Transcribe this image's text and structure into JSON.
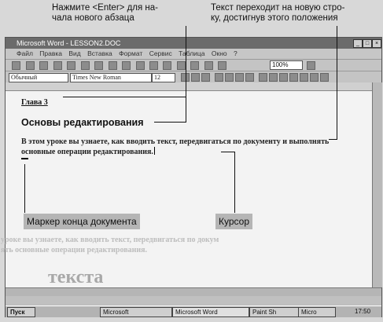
{
  "callouts": {
    "enter": [
      "Нажмите <Enter> для на-",
      "чала нового абзаца"
    ],
    "wrap": [
      "Текст переходит на новую стро-",
      "ку, достигнув этого положения"
    ],
    "end_marker": "Маркер конца документа",
    "cursor": "Курсор"
  },
  "window": {
    "title": "Microsoft Word - LESSON2.DOC",
    "menus": [
      "Файл",
      "Правка",
      "Вид",
      "Вставка",
      "Формат",
      "Сервис",
      "Таблица",
      "Окно",
      "?"
    ]
  },
  "format_bar": {
    "style": "Обычный",
    "font": "Times New Roman",
    "size": "12",
    "zoom": "100%"
  },
  "document": {
    "chapter": "Глава 3",
    "heading": "Основы редактирования",
    "body": "В этом уроке вы узнаете, как вводить текст, передвигаться по документу и выполнять основные операции редактирования."
  },
  "background_text": {
    "line1": "уроке вы узнаете, как вводить текст, передвигаться по докум",
    "line2": "ять основные операции редактирования.",
    "big": "текста"
  },
  "taskbar": {
    "start": "Пуск",
    "tasks": [
      "Microsoft",
      "Microsoft Word",
      "Paint Sh",
      "Micro"
    ],
    "clock": "17:50"
  }
}
